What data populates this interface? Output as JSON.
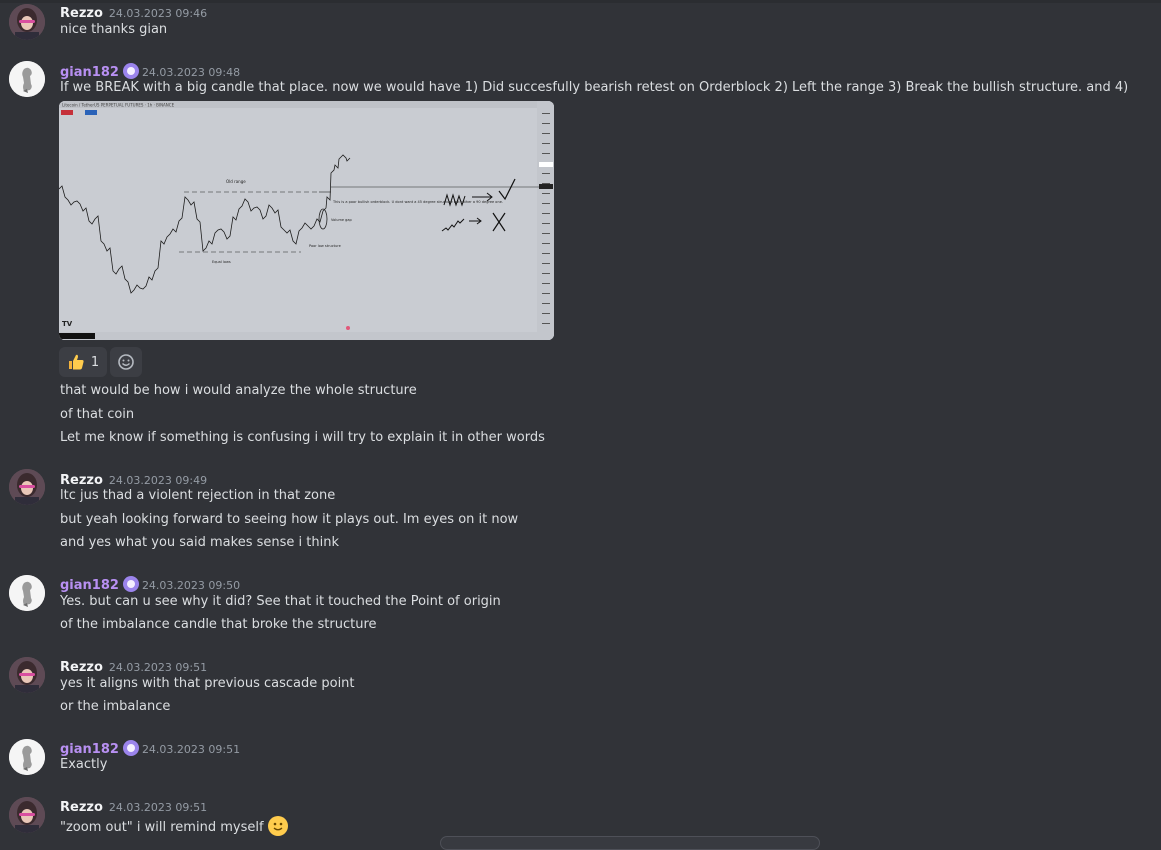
{
  "colors": {
    "background": "#313338",
    "rezzo_name": "#f2f3f5",
    "gian_name": "#b890f2",
    "timestamp": "#949ba4",
    "text": "#dbdee1"
  },
  "messages": [
    {
      "author": "Rezzo",
      "time": "24.03.2023 09:46",
      "lines": [
        "nice thanks gian"
      ]
    },
    {
      "author": "gian182",
      "time": "24.03.2023 09:48",
      "lines": [
        "If we BREAK with a big candle that place. now we would have 1) Did succesfully bearish retest on Orderblock 2) Left the range 3) Break the bullish structure. and 4)"
      ],
      "attachment": {
        "icon": "chart-image",
        "chart_header": "Litecoin / TetherUS PERPETUAL FUTURES · 1h · BINANCE",
        "annotations": {
          "old_range": "Old range",
          "poor_bullish": "This is a poor bullish orderblock. U dont want a 45 degree structure but rather a 90 degree one.",
          "volume_gap": "Volume gap",
          "poor_low": "Poor low structure",
          "equal_lows": "Equal lows"
        }
      },
      "reactions": [
        {
          "icon": "thumbs-up-icon",
          "count": "1"
        },
        {
          "icon": "add-reaction-icon",
          "count": ""
        }
      ],
      "followups": [
        "that would be how i would analyze the whole structure",
        "of that coin",
        "Let me know if something is confusing i will try to explain it in other words"
      ]
    },
    {
      "author": "Rezzo",
      "time": "24.03.2023 09:49",
      "lines": [
        "ltc jus thad a violent rejection in that zone",
        "but yeah looking forward to seeing how it plays out. Im eyes on it now",
        "and yes what you said makes sense i think"
      ]
    },
    {
      "author": "gian182",
      "time": "24.03.2023 09:50",
      "lines": [
        "Yes. but can u see why it did? See that it touched the Point of origin",
        "of the imbalance candle that broke the structure"
      ]
    },
    {
      "author": "Rezzo",
      "time": "24.03.2023 09:51",
      "lines": [
        "yes it aligns with that previous cascade point",
        "or the imbalance"
      ]
    },
    {
      "author": "gian182",
      "time": "24.03.2023 09:51",
      "lines": [
        "Exactly"
      ]
    },
    {
      "author": "Rezzo",
      "time": "24.03.2023 09:51",
      "lines": [
        "\"zoom out\" i will remind myself"
      ],
      "trailing_emoji": "slightly-smiling-face-icon"
    }
  ]
}
